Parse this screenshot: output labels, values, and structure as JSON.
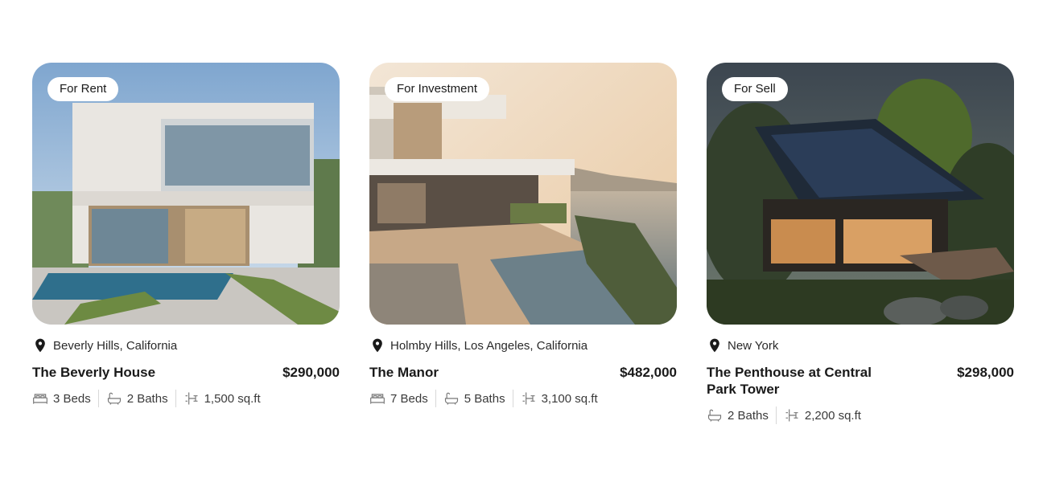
{
  "listings": [
    {
      "badge": "For Rent",
      "location": "Beverly Hills, California",
      "title": "The Beverly House",
      "price": "$290,000",
      "beds": "3 Beds",
      "baths": "2 Baths",
      "area": "1,500 sq.ft"
    },
    {
      "badge": "For Investment",
      "location": "Holmby Hills, Los Angeles, California",
      "title": "The Manor",
      "price": "$482,000",
      "beds": "7 Beds",
      "baths": "5 Baths",
      "area": "3,100 sq.ft"
    },
    {
      "badge": "For Sell",
      "location": "New York",
      "title": "The Penthouse at Central Park Tower",
      "price": "$298,000",
      "baths": "2 Baths",
      "area": "2,200 sq.ft"
    }
  ],
  "icons": {
    "location": "map-pin-icon",
    "beds": "bed-icon",
    "baths": "bathtub-icon",
    "area": "floor-plan-icon"
  }
}
